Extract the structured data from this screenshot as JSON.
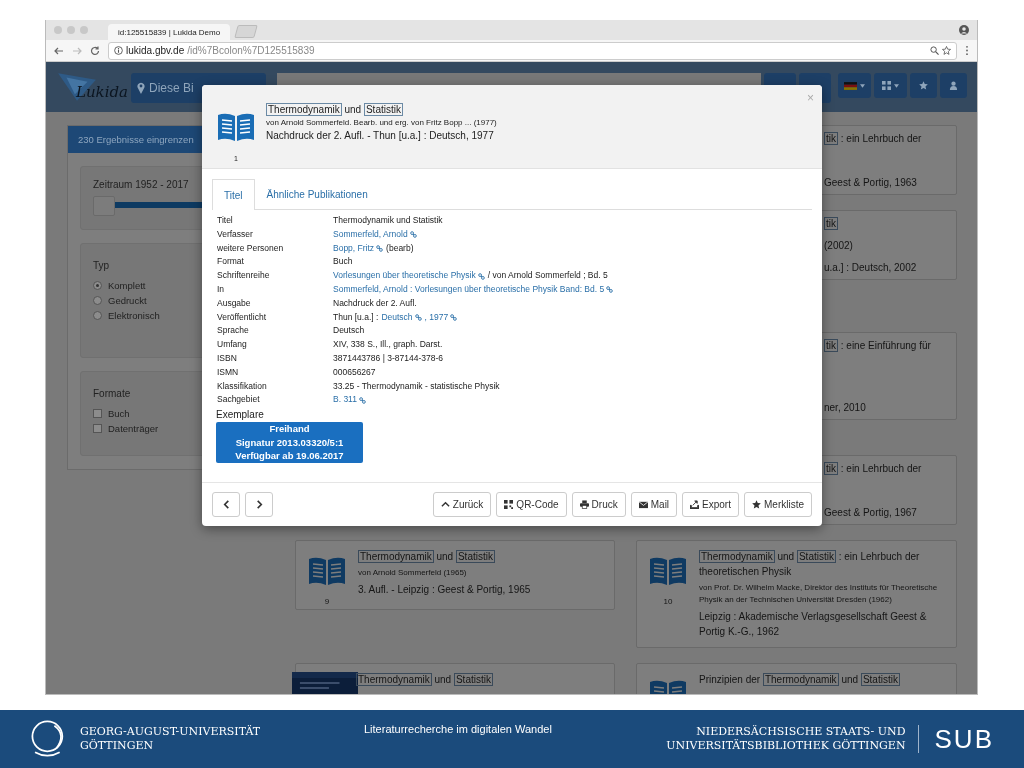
{
  "browser": {
    "tab_title": "id:125515839 | Lukida Demo",
    "url_host": "lukida.gbv.de",
    "url_path": "/id%7Bcolon%7D125515839"
  },
  "navbar": {
    "logo": "Lukida",
    "library_button": "Diese Bi"
  },
  "sidebar": {
    "header": "230 Ergebnisse eingrenzen",
    "slider": {
      "label": "Zeitraum 1952 - 2017",
      "level": 1
    },
    "type_title": "Typ",
    "types": [
      {
        "label": "Komplett",
        "selected": true
      },
      {
        "label": "Gedruckt",
        "selected": false
      },
      {
        "label": "Elektronisch",
        "selected": false
      }
    ],
    "formats_title": "Formate",
    "formats": [
      {
        "label": "Buch",
        "checked": false
      },
      {
        "label": "Datenträger",
        "checked": false
      }
    ]
  },
  "side_results": [
    {
      "title": [
        {
          "text": "tik",
          "highlight": true
        },
        {
          "text": " : ein Lehrbuch der",
          "highlight": false
        }
      ],
      "lines": [
        "Geest & Portig, 1963"
      ]
    },
    {
      "title": [
        {
          "text": "tik",
          "highlight": true
        }
      ],
      "lines": [
        "(2002)",
        "u.a.] : Deutsch, 2002"
      ]
    },
    {
      "title": [
        {
          "text": "tik",
          "highlight": true
        },
        {
          "text": " : eine Einführung für",
          "highlight": false
        }
      ],
      "lines": [
        "ner, 2010"
      ]
    },
    {
      "title": [
        {
          "text": "tik",
          "highlight": true
        },
        {
          "text": " : ein Lehrbuch der",
          "highlight": false
        }
      ],
      "lines": [
        "Geest & Portig, 1967"
      ]
    }
  ],
  "results": [
    {
      "kind": "book",
      "number": "9",
      "title": [
        {
          "text": "Thermodynamik",
          "highlight": true
        },
        {
          "text": " und ",
          "highlight": false
        },
        {
          "text": "Statistik",
          "highlight": true
        }
      ],
      "author": "von Arnold Sommerfeld (1965)",
      "edition": "3. Aufl. - Leipzig : Geest & Portig, 1965"
    },
    {
      "kind": "book",
      "number": "10",
      "title": [
        {
          "text": "Thermodynamik",
          "highlight": true
        },
        {
          "text": " und ",
          "highlight": false
        },
        {
          "text": "Statistik",
          "highlight": true
        },
        {
          "text": " : ein Lehrbuch der theoretischen Physik",
          "highlight": false
        }
      ],
      "author": "von Prof. Dr. Wilhelm Macke, Direktor des Instituts für Theoretische Physik an der Technischen Universität Dresden (1962)",
      "edition": "Leipzig : Akademische Verlagsgesellschaft Geest & Portig K.-G., 1962"
    },
    {
      "kind": "picture",
      "title": [
        {
          "text": "Thermodynamik",
          "highlight": true
        },
        {
          "text": " und ",
          "highlight": false
        },
        {
          "text": "Statistik",
          "highlight": true
        }
      ]
    },
    {
      "kind": "book",
      "title": [
        {
          "text": "Prinzipien der ",
          "highlight": false
        },
        {
          "text": "Thermodynamik",
          "highlight": true
        },
        {
          "text": " und ",
          "highlight": false
        },
        {
          "text": "Statistik",
          "highlight": true
        }
      ]
    }
  ],
  "modal": {
    "number": "1",
    "close": "×",
    "title": [
      {
        "text": "Thermodynamik",
        "highlight": true
      },
      {
        "text": " und ",
        "highlight": false
      },
      {
        "text": "Statistik",
        "highlight": true
      }
    ],
    "author": "von Arnold Sommerfeld. Bearb. und erg. von Fritz Bopp ... (1977)",
    "edition": "Nachdruck der 2. Aufl. - Thun [u.a.] : Deutsch, 1977",
    "tabs": [
      {
        "label": "Titel",
        "selected": true
      },
      {
        "label": "Ähnliche Publikationen",
        "selected": false
      }
    ],
    "details": [
      {
        "label": "Titel",
        "value": [
          {
            "kind": "text",
            "text": "Thermodynamik und Statistik"
          }
        ]
      },
      {
        "label": "Verfasser",
        "value": [
          {
            "kind": "link",
            "text": "Sommerfeld, Arnold"
          }
        ]
      },
      {
        "label": "weitere Personen",
        "value": [
          {
            "kind": "link",
            "text": "Bopp, Fritz"
          },
          {
            "kind": "text",
            "text": "(bearb)"
          }
        ]
      },
      {
        "label": "Format",
        "value": [
          {
            "kind": "text",
            "text": "Buch"
          }
        ]
      },
      {
        "label": "Schriftenreihe",
        "value": [
          {
            "kind": "link",
            "text": "Vorlesungen über theoretische Physik"
          },
          {
            "kind": "text",
            "text": "/ von Arnold Sommerfeld ; Bd. 5"
          }
        ]
      },
      {
        "label": "In",
        "value": [
          {
            "kind": "link",
            "text": "Sommerfeld, Arnold : Vorlesungen über theoretische Physik Band: Bd. 5"
          }
        ]
      },
      {
        "label": "Ausgabe",
        "value": [
          {
            "kind": "text",
            "text": "Nachdruck der 2. Aufl."
          }
        ]
      },
      {
        "label": "Veröffentlicht",
        "value": [
          {
            "kind": "text",
            "text": "Thun [u.a.] :"
          },
          {
            "kind": "link",
            "text": "Deutsch"
          },
          {
            "kind": "link",
            "text": ", 1977"
          }
        ]
      },
      {
        "label": "Sprache",
        "value": [
          {
            "kind": "text",
            "text": "Deutsch"
          }
        ]
      },
      {
        "label": "Umfang",
        "value": [
          {
            "kind": "text",
            "text": "XIV, 338 S., Ill., graph. Darst."
          }
        ]
      },
      {
        "label": "ISBN",
        "value": [
          {
            "kind": "text",
            "text": "3871443786 | 3-87144-378-6"
          }
        ]
      },
      {
        "label": "ISMN",
        "value": [
          {
            "kind": "text",
            "text": "000656267"
          }
        ]
      },
      {
        "label": "Klassifikation",
        "value": [
          {
            "kind": "text",
            "text": "33.25 - Thermodynamik - statistische Physik"
          }
        ]
      },
      {
        "label": "Sachgebiet",
        "value": [
          {
            "kind": "link",
            "text": "B. 311"
          }
        ]
      }
    ],
    "copies_title": "Exemplare",
    "copy": [
      "Freihand",
      "Signatur 2013.03320/5:1",
      "Verfügbar ab 19.06.2017"
    ],
    "actions": [
      "Zurück",
      "QR-Code",
      "Druck",
      "Mail",
      "Export",
      "Merkliste"
    ]
  },
  "footer": {
    "university": [
      "GEORG-AUGUST-UNIVERSITÄT",
      "GÖTTINGEN"
    ],
    "caption": "Literaturrecherche im digitalen Wandel",
    "library": [
      "NIEDERSÄCHSISCHE STAATS- UND",
      "UNIVERSITÄTSBIBLIOTHEK GÖTTINGEN"
    ],
    "library_logo": "SUB"
  }
}
